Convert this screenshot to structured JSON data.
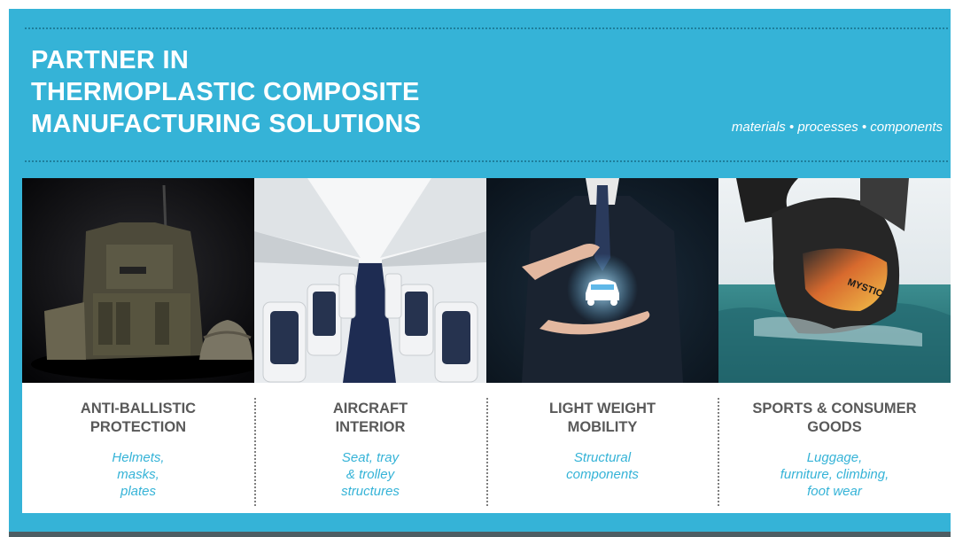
{
  "title_lines": [
    "PARTNER IN",
    "THERMOPLASTIC COMPOSITE",
    "MANUFACTURING SOLUTIONS"
  ],
  "tagline": "materials • processes • components",
  "cards": [
    {
      "heading": [
        "ANTI-BALLISTIC",
        "PROTECTION"
      ],
      "sub": [
        "Helmets,",
        "masks,",
        "plates"
      ],
      "photo": "tactical-vest-and-helmet"
    },
    {
      "heading": [
        "AIRCRAFT",
        "INTERIOR"
      ],
      "sub": [
        "Seat, tray",
        "& trolley",
        "structures"
      ],
      "photo": "aircraft-cabin-seats"
    },
    {
      "heading": [
        "LIGHT WEIGHT",
        "MOBILITY"
      ],
      "sub": [
        "Structural",
        "components"
      ],
      "photo": "businessman-holding-car-icon"
    },
    {
      "heading": [
        "SPORTS & CONSUMER",
        "GOODS"
      ],
      "sub": [
        "Luggage,",
        "furniture, climbing,",
        "foot wear"
      ],
      "photo": "surfer-in-wetsuit"
    }
  ],
  "photo_text": {
    "mystic": "MYSTIC"
  },
  "colors": {
    "accent": "#35b3d7",
    "heading": "#595959",
    "dotted": "#1e7f9c"
  }
}
